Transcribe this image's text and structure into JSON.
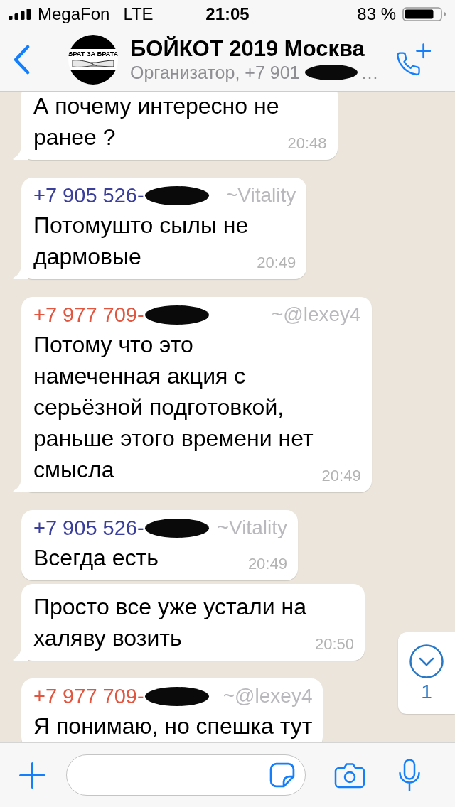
{
  "status_bar": {
    "carrier": "MegaFon",
    "network": "LTE",
    "time": "21:05",
    "battery": "83 %"
  },
  "header": {
    "avatar_text": "БРАТ ЗА БРАТА",
    "title": "БОЙКОТ 2019 Москва",
    "subtitle": "Организатор, +7 901",
    "subtitle_redacted": true,
    "subtitle_end": "…"
  },
  "messages": [
    {
      "text": "А почему интересно не\nранее ?",
      "time": "20:48",
      "tail": true
    },
    {
      "sender": {
        "phone": "+7 905 526-",
        "redacted": true,
        "name": "~Vitality",
        "color": "#3b3f9c"
      },
      "text": "Потомушто сылы не\nдармовые",
      "time": "20:49",
      "tail": true
    },
    {
      "sender": {
        "phone": "+7 977 709-",
        "redacted": true,
        "name": "~@lexey4",
        "color": "#e2553e"
      },
      "text": "Потому что это\nнамеченная акция с\nсерьёзной подготовкой,\nраньше этого времени нет\nсмысла",
      "time": "20:49",
      "tail": true
    },
    {
      "sender": {
        "phone": "+7 905 526-",
        "redacted": true,
        "name": "~Vitality",
        "color": "#3b3f9c"
      },
      "text": "Всегда есть",
      "time": "20:49",
      "tail": false
    },
    {
      "text": "Просто все уже устали на\nхаляву возить",
      "time": "20:50",
      "tail": true
    },
    {
      "sender": {
        "phone": "+7 977 709-",
        "redacted": true,
        "name": "~@lexey4",
        "color": "#e2553e"
      },
      "text": "Я понимаю, но спешка тут",
      "tail": false
    }
  ],
  "scroll_down": {
    "count": "1"
  }
}
